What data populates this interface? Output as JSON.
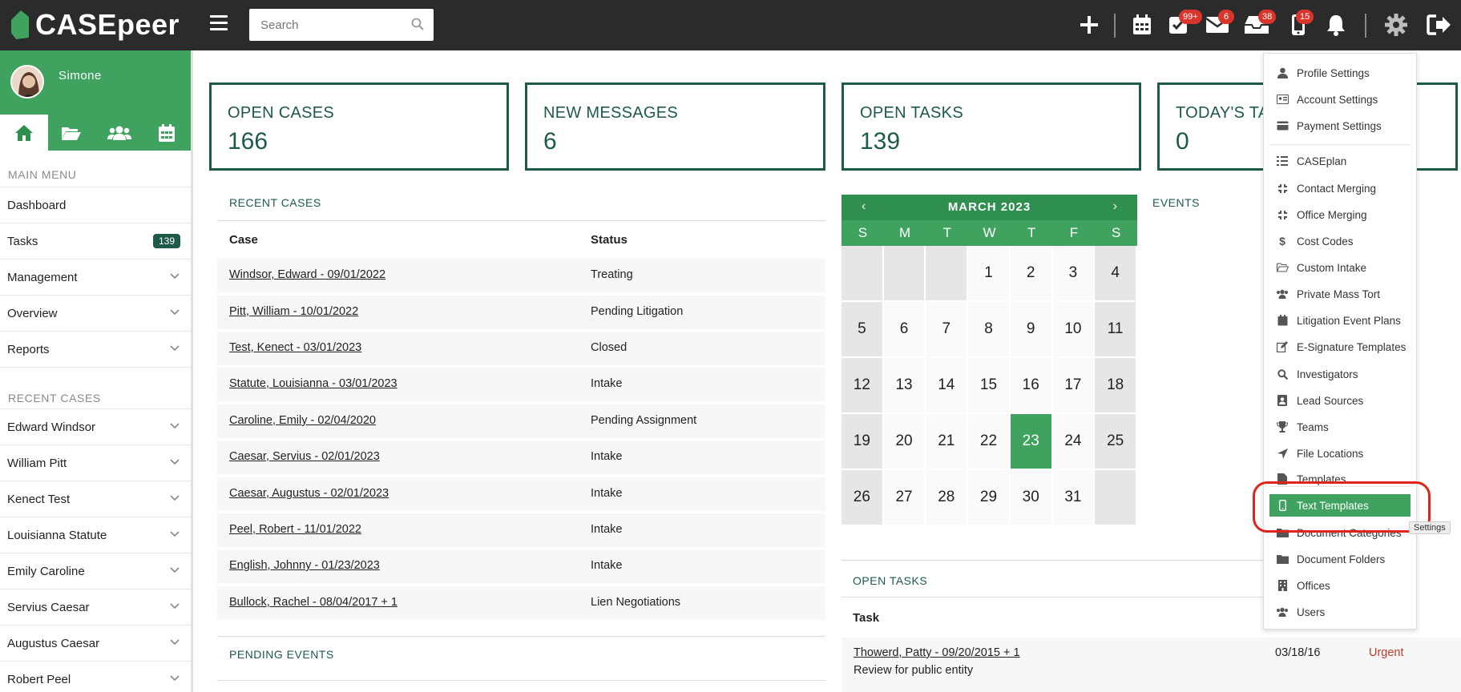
{
  "topbar": {
    "app_name": "CASEpeer",
    "search_placeholder": "Search",
    "badges": {
      "tasks": "99+",
      "messages": "6",
      "inbox": "38",
      "phone": "15"
    }
  },
  "sidebar": {
    "user_name": "Simone",
    "main_menu_title": "MAIN MENU",
    "main_menu": [
      {
        "label": "Dashboard"
      },
      {
        "label": "Tasks",
        "badge": "139"
      },
      {
        "label": "Management"
      },
      {
        "label": "Overview"
      },
      {
        "label": "Reports"
      }
    ],
    "recent_title": "RECENT CASES",
    "recent": [
      "Edward Windsor",
      "William Pitt",
      "Kenect Test",
      "Louisianna Statute",
      "Emily Caroline",
      "Servius Caesar",
      "Augustus Caesar",
      "Robert Peel"
    ]
  },
  "cards": [
    {
      "title": "OPEN CASES",
      "value": "166"
    },
    {
      "title": "NEW MESSAGES",
      "value": "6"
    },
    {
      "title": "OPEN TASKS",
      "value": "139"
    },
    {
      "title": "TODAY'S TA",
      "value": "0"
    }
  ],
  "recent_cases": {
    "title": "RECENT CASES",
    "col_case": "Case",
    "col_status": "Status",
    "rows": [
      {
        "case": "Windsor, Edward - 09/01/2022",
        "status": "Treating"
      },
      {
        "case": "Pitt, William - 10/01/2022",
        "status": "Pending Litigation"
      },
      {
        "case": "Test, Kenect - 03/01/2023",
        "status": "Closed"
      },
      {
        "case": "Statute, Louisianna - 03/01/2023",
        "status": "Intake"
      },
      {
        "case": "Caroline, Emily - 02/04/2020",
        "status": "Pending Assignment"
      },
      {
        "case": "Caesar, Servius - 02/01/2023",
        "status": "Intake"
      },
      {
        "case": "Caesar, Augustus - 02/01/2023",
        "status": "Intake"
      },
      {
        "case": "Peel, Robert - 11/01/2022",
        "status": "Intake"
      },
      {
        "case": "English, Johnny - 01/23/2023",
        "status": "Intake"
      },
      {
        "case": "Bullock, Rachel - 08/04/2017 + 1",
        "status": "Lien Negotiations"
      }
    ]
  },
  "pending_events_title": "PENDING EVENTS",
  "calendar": {
    "month": "MARCH 2023",
    "prev": "‹",
    "next": "›",
    "day_headers": [
      "S",
      "M",
      "T",
      "W",
      "T",
      "F",
      "S"
    ],
    "cells": [
      "",
      "",
      "",
      "1",
      "2",
      "3",
      "4",
      "5",
      "6",
      "7",
      "8",
      "9",
      "10",
      "11",
      "12",
      "13",
      "14",
      "15",
      "16",
      "17",
      "18",
      "19",
      "20",
      "21",
      "22",
      "23",
      "24",
      "25",
      "26",
      "27",
      "28",
      "29",
      "30",
      "31",
      ""
    ],
    "today": "23"
  },
  "events_title": "EVENTS",
  "open_tasks": {
    "title": "OPEN TASKS",
    "col_task": "Task",
    "row": {
      "case": "Thowerd, Patty - 09/20/2015 + 1",
      "desc": "Review for public entity",
      "date": "03/18/16",
      "priority": "Urgent"
    }
  },
  "settings_menu": {
    "items": [
      {
        "label": "Profile Settings",
        "icon": "user-icon"
      },
      {
        "label": "Account Settings",
        "icon": "id-card-icon"
      },
      {
        "label": "Payment Settings",
        "icon": "credit-card-icon"
      },
      {
        "label": "CASEplan",
        "icon": "list-icon"
      },
      {
        "label": "Contact Merging",
        "icon": "merge-icon"
      },
      {
        "label": "Office Merging",
        "icon": "merge-icon"
      },
      {
        "label": "Cost Codes",
        "icon": "dollar-icon"
      },
      {
        "label": "Custom Intake",
        "icon": "folder-open-icon"
      },
      {
        "label": "Private Mass Tort",
        "icon": "users-icon"
      },
      {
        "label": "Litigation Event Plans",
        "icon": "calendar-icon"
      },
      {
        "label": "E-Signature Templates",
        "icon": "edit-icon"
      },
      {
        "label": "Investigators",
        "icon": "search-icon"
      },
      {
        "label": "Lead Sources",
        "icon": "contact-icon"
      },
      {
        "label": "Teams",
        "icon": "trophy-icon"
      },
      {
        "label": "File Locations",
        "icon": "location-arrow-icon"
      },
      {
        "label": "Templates",
        "icon": "file-icon"
      },
      {
        "label": "Text Templates",
        "icon": "mobile-icon",
        "active": true
      },
      {
        "label": "Document Categories",
        "icon": "folder-icon"
      },
      {
        "label": "Document Folders",
        "icon": "folder-icon"
      },
      {
        "label": "Offices",
        "icon": "building-icon"
      },
      {
        "label": "Users",
        "icon": "users-icon"
      }
    ],
    "tooltip": "Settings"
  },
  "colors": {
    "brand_green": "#3fa35f",
    "dark_green": "#1d5a49",
    "topbar": "#2b2b2b",
    "badge_red": "#d9362b",
    "urgent": "#c0392b"
  }
}
